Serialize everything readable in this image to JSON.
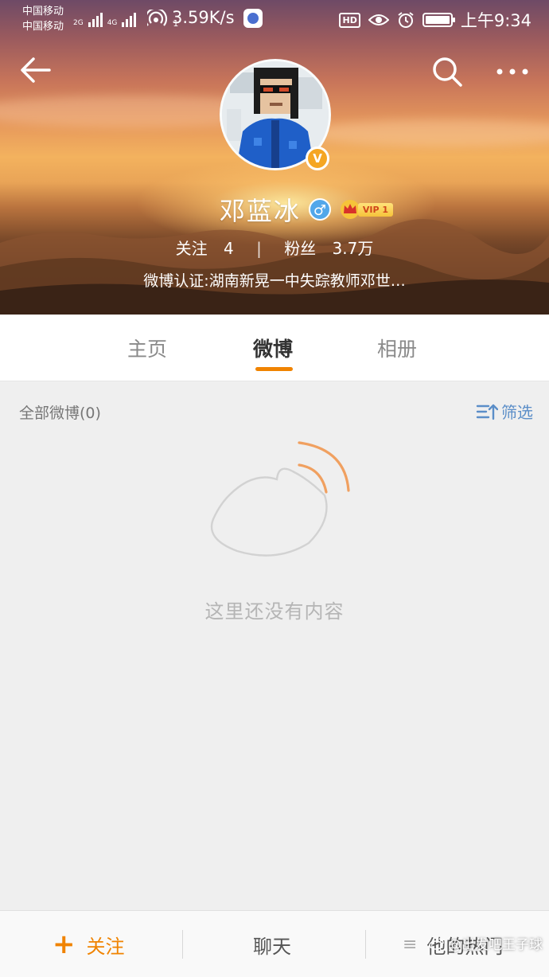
{
  "status_bar": {
    "carrier_1": "中国移动",
    "carrier_2": "中国移动",
    "sim1_type": "2G",
    "sim2_type": "4G",
    "hotspot_count": "1",
    "net_speed": "3.59K/s",
    "hd_label": "HD",
    "time": "上午9:34"
  },
  "nav": {
    "back_icon": "back-arrow-icon",
    "search_icon": "search-icon",
    "more_icon": "more-dots-icon"
  },
  "profile": {
    "name": "邓蓝冰",
    "verify_badge": "V",
    "gender_symbol": "♂",
    "vip_label": "VIP 1",
    "following_label": "关注",
    "following_count": "4",
    "followers_label": "粉丝",
    "followers_count": "3.7万",
    "verification": "微博认证:湖南新晃一中失踪教师邓世…"
  },
  "tabs": [
    {
      "label": "主页",
      "active": false
    },
    {
      "label": "微博",
      "active": true
    },
    {
      "label": "相册",
      "active": false
    }
  ],
  "feed": {
    "all_label": "全部微博(0)",
    "filter_label": "筛选",
    "empty_text": "这里还没有内容"
  },
  "bottom_bar": {
    "follow_label": "关注",
    "chat_label": "聊天",
    "hot_label": "他的热门"
  },
  "watermark": "@出发吧王子球",
  "colors": {
    "accent": "#f08300",
    "filter_blue": "#5b8ec8",
    "verify_gold": "#f5a623",
    "gender_blue": "#52a7ea"
  }
}
